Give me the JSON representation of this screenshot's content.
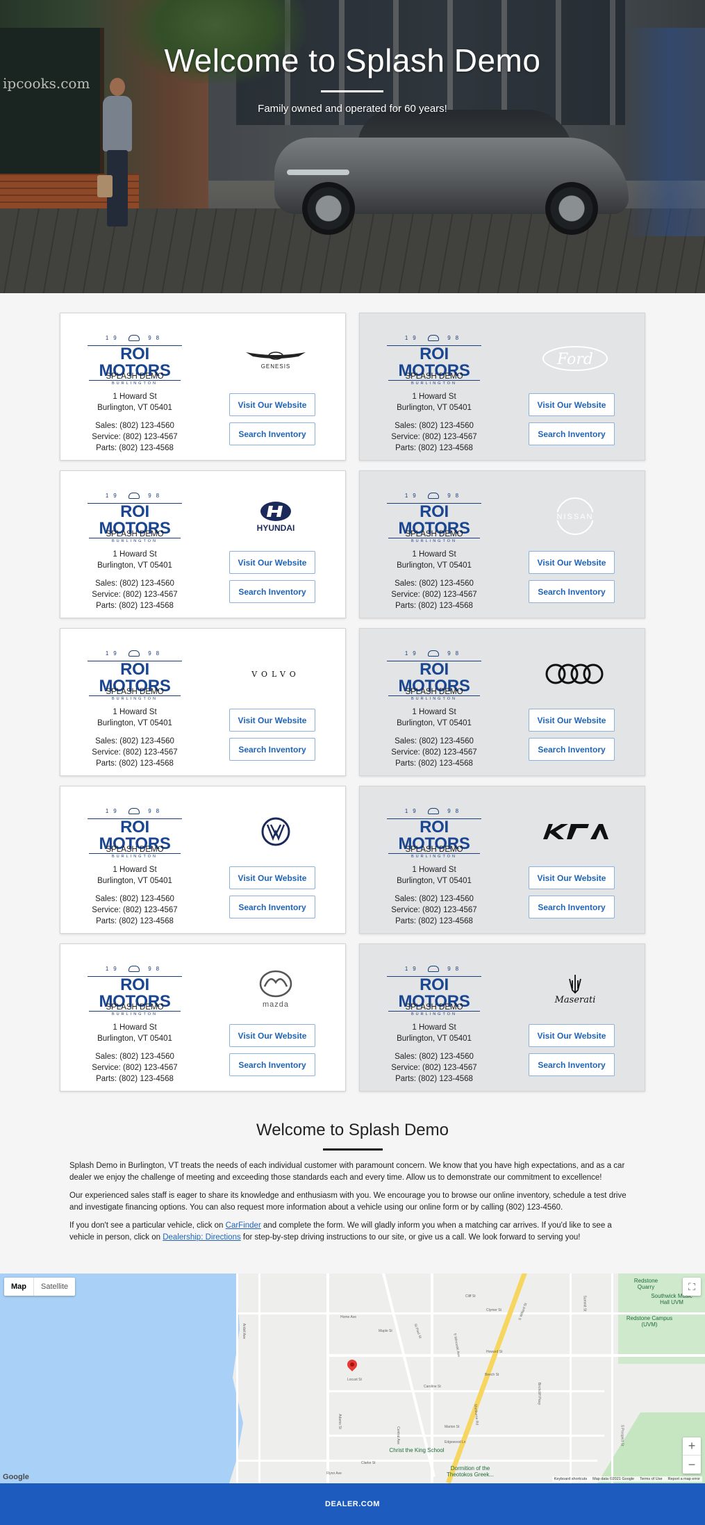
{
  "hero": {
    "title": "Welcome to Splash Demo",
    "subtitle": "Family owned and operated for 60 years!",
    "storefront_text": "ipcooks.com"
  },
  "dealer_logo": {
    "year_left": "19",
    "year_right": "98",
    "name": "ROI MOTORS",
    "city": "BURLINGTON"
  },
  "cards": [
    {
      "brand": "Genesis",
      "brand_logo": "GENESIS",
      "dealer": "SPLASH DEMO",
      "address1": "1 Howard St",
      "address2": "Burlington, VT 05401",
      "sales": "Sales: (802) 123-4560",
      "service": "Service: (802) 123-4567",
      "parts": "Parts: (802) 123-4568",
      "visit": "Visit Our Website",
      "search": "Search Inventory"
    },
    {
      "brand": "Ford",
      "brand_logo": "Ford",
      "dealer": "SPLASH DEMO",
      "address1": "1 Howard St",
      "address2": "Burlington, VT 05401",
      "sales": "Sales: (802) 123-4560",
      "service": "Service: (802) 123-4567",
      "parts": "Parts: (802) 123-4568",
      "visit": "Visit Our Website",
      "search": "Search Inventory"
    },
    {
      "brand": "Hyundai",
      "brand_logo": "HYUNDAI",
      "dealer": "SPLASH DEMO",
      "address1": "1 Howard St",
      "address2": "Burlington, VT 05401",
      "sales": "Sales: (802) 123-4560",
      "service": "Service: (802) 123-4567",
      "parts": "Parts: (802) 123-4568",
      "visit": "Visit Our Website",
      "search": "Search Inventory"
    },
    {
      "brand": "Nissan",
      "brand_logo": "NISSAN",
      "dealer": "SPLASH DEMO",
      "address1": "1 Howard St",
      "address2": "Burlington, VT 05401",
      "sales": "Sales: (802) 123-4560",
      "service": "Service: (802) 123-4567",
      "parts": "Parts: (802) 123-4568",
      "visit": "Visit Our Website",
      "search": "Search Inventory"
    },
    {
      "brand": "Volvo",
      "brand_logo": "VOLVO",
      "dealer": "SPLASH DEMO",
      "address1": "1 Howard St",
      "address2": "Burlington, VT 05401",
      "sales": "Sales: (802) 123-4560",
      "service": "Service: (802) 123-4567",
      "parts": "Parts: (802) 123-4568",
      "visit": "Visit Our Website",
      "search": "Search Inventory"
    },
    {
      "brand": "Audi",
      "brand_logo": "",
      "dealer": "SPLASH DEMO",
      "address1": "1 Howard St",
      "address2": "Burlington, VT 05401",
      "sales": "Sales: (802) 123-4560",
      "service": "Service: (802) 123-4567",
      "parts": "Parts: (802) 123-4568",
      "visit": "Visit Our Website",
      "search": "Search Inventory"
    },
    {
      "brand": "Volkswagen",
      "brand_logo": "VW",
      "dealer": "SPLASH DEMO",
      "address1": "1 Howard St",
      "address2": "Burlington, VT 05401",
      "sales": "Sales: (802) 123-4560",
      "service": "Service: (802) 123-4567",
      "parts": "Parts: (802) 123-4568",
      "visit": "Visit Our Website",
      "search": "Search Inventory"
    },
    {
      "brand": "Kia",
      "brand_logo": "KIA",
      "dealer": "SPLASH DEMO",
      "address1": "1 Howard St",
      "address2": "Burlington, VT 05401",
      "sales": "Sales: (802) 123-4560",
      "service": "Service: (802) 123-4567",
      "parts": "Parts: (802) 123-4568",
      "visit": "Visit Our Website",
      "search": "Search Inventory"
    },
    {
      "brand": "Mazda",
      "brand_logo": "mazda",
      "dealer": "SPLASH DEMO",
      "address1": "1 Howard St",
      "address2": "Burlington, VT 05401",
      "sales": "Sales: (802) 123-4560",
      "service": "Service: (802) 123-4567",
      "parts": "Parts: (802) 123-4568",
      "visit": "Visit Our Website",
      "search": "Search Inventory"
    },
    {
      "brand": "Maserati",
      "brand_logo": "Maserati",
      "dealer": "SPLASH DEMO",
      "address1": "1 Howard St",
      "address2": "Burlington, VT 05401",
      "sales": "Sales: (802) 123-4560",
      "service": "Service: (802) 123-4567",
      "parts": "Parts: (802) 123-4568",
      "visit": "Visit Our Website",
      "search": "Search Inventory"
    }
  ],
  "welcome": {
    "title": "Welcome to Splash Demo",
    "p1": "Splash Demo in Burlington, VT treats the needs of each individual customer with paramount concern. We know that you have high expectations, and as a car dealer we enjoy the challenge of meeting and exceeding those standards each and every time. Allow us to demonstrate our commitment to excellence!",
    "p2": "Our experienced sales staff is eager to share its knowledge and enthusiasm with you. We encourage you to browse our online inventory, schedule a test drive and investigate financing options. You can also request more information about a vehicle using our online form or by calling (802) 123-4560.",
    "p3_a": "If you don't see a particular vehicle, click on ",
    "p3_link1": "CarFinder",
    "p3_b": " and complete the form. We will gladly inform you when a matching car arrives. If you'd like to see a vehicle in person, click on ",
    "p3_link2": "Dealership: Directions",
    "p3_c": " for step-by-step driving instructions to our site, or give us a call. We look forward to serving you!"
  },
  "map": {
    "type_map": "Map",
    "type_satellite": "Satellite",
    "google": "Google",
    "attrib": [
      "Keyboard shortcuts",
      "Map data ©2021 Google",
      "Terms of Use",
      "Report a map error"
    ],
    "places": {
      "redstone": "Redstone Quarry",
      "southwick": "Southwick Music Hall UVM",
      "campus": "Redstone Campus (UVM)",
      "christ_king": "Christ the King School",
      "dormition": "Dormition of the Theotokos Greek..."
    },
    "streets": [
      "S Willard St",
      "St Paul St",
      "S Winooski Ave",
      "Howard St",
      "Locust St",
      "Marion St",
      "Birchcliff Pkwy",
      "Shelburne Rd",
      "Caroline St",
      "Beech St",
      "Clymer St",
      "Maple St",
      "Ardell Ave",
      "Central Ave",
      "S Prospect St",
      "Summit St",
      "Cliff St",
      "Edgewood Ln",
      "Adams St",
      "Flynn Ave",
      "Clarke St",
      "Home Ave"
    ]
  },
  "footer": {
    "logo": "DEALER.COM"
  }
}
